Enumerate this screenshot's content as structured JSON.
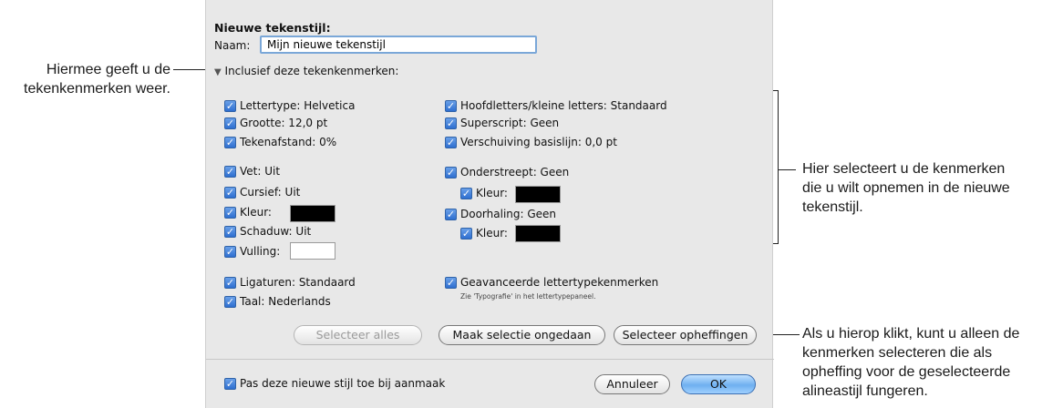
{
  "dialog": {
    "title": "Nieuwe tekenstijl:",
    "name_label": "Naam:",
    "name_value": "Mijn nieuwe tekenstijl",
    "include_label": "Inclusief deze tekenkenmerken:",
    "left_group1": [
      {
        "label": "Lettertype:  Helvetica"
      },
      {
        "label": "Grootte: 12,0 pt"
      },
      {
        "label": "Tekenafstand: 0%"
      }
    ],
    "left_group2": [
      {
        "label": "Vet: Uit"
      },
      {
        "label": "Cursief: Uit"
      },
      {
        "label": "Kleur:"
      },
      {
        "label": "Schaduw: Uit"
      },
      {
        "label": "Vulling:"
      }
    ],
    "left_group3": [
      {
        "label": "Ligaturen: Standaard"
      },
      {
        "label": "Taal: Nederlands"
      }
    ],
    "right_group1": [
      {
        "label": "Hoofdletters/kleine letters: Standaard"
      },
      {
        "label": "Superscript: Geen"
      },
      {
        "label": "Verschuiving basislijn: 0,0 pt"
      }
    ],
    "right_group2": [
      {
        "label": "Onderstreept: Geen"
      },
      {
        "label": "Kleur:"
      },
      {
        "label": "Doorhaling: Geen"
      },
      {
        "label": "Kleur:"
      }
    ],
    "advanced_label": "Geavanceerde lettertypekenmerken",
    "advanced_note": "Zie 'Typografie' in het lettertypepaneel.",
    "buttons": {
      "select_all": "Selecteer alles",
      "undo_selection": "Maak selectie ongedaan",
      "select_overrides": "Selecteer opheffingen",
      "cancel": "Annuleer",
      "ok": "OK"
    },
    "apply_label": "Pas deze nieuwe stijl toe bij aanmaak",
    "colors": {
      "black_swatch": "#000000",
      "white_swatch": "#ffffff",
      "checkbox": "#2e6fd0"
    }
  },
  "callouts": {
    "left": [
      "Hiermee geeft u de",
      "tekenkenmerken weer."
    ],
    "right_top": [
      "Hier selecteert u de kenmerken",
      "die u wilt opnemen in de nieuwe",
      "tekenstijl."
    ],
    "right_bottom": [
      "Als u hierop klikt, kunt u alleen de",
      "kenmerken selecteren die als",
      "opheffing voor de geselecteerde",
      "alineastijl fungeren."
    ]
  }
}
